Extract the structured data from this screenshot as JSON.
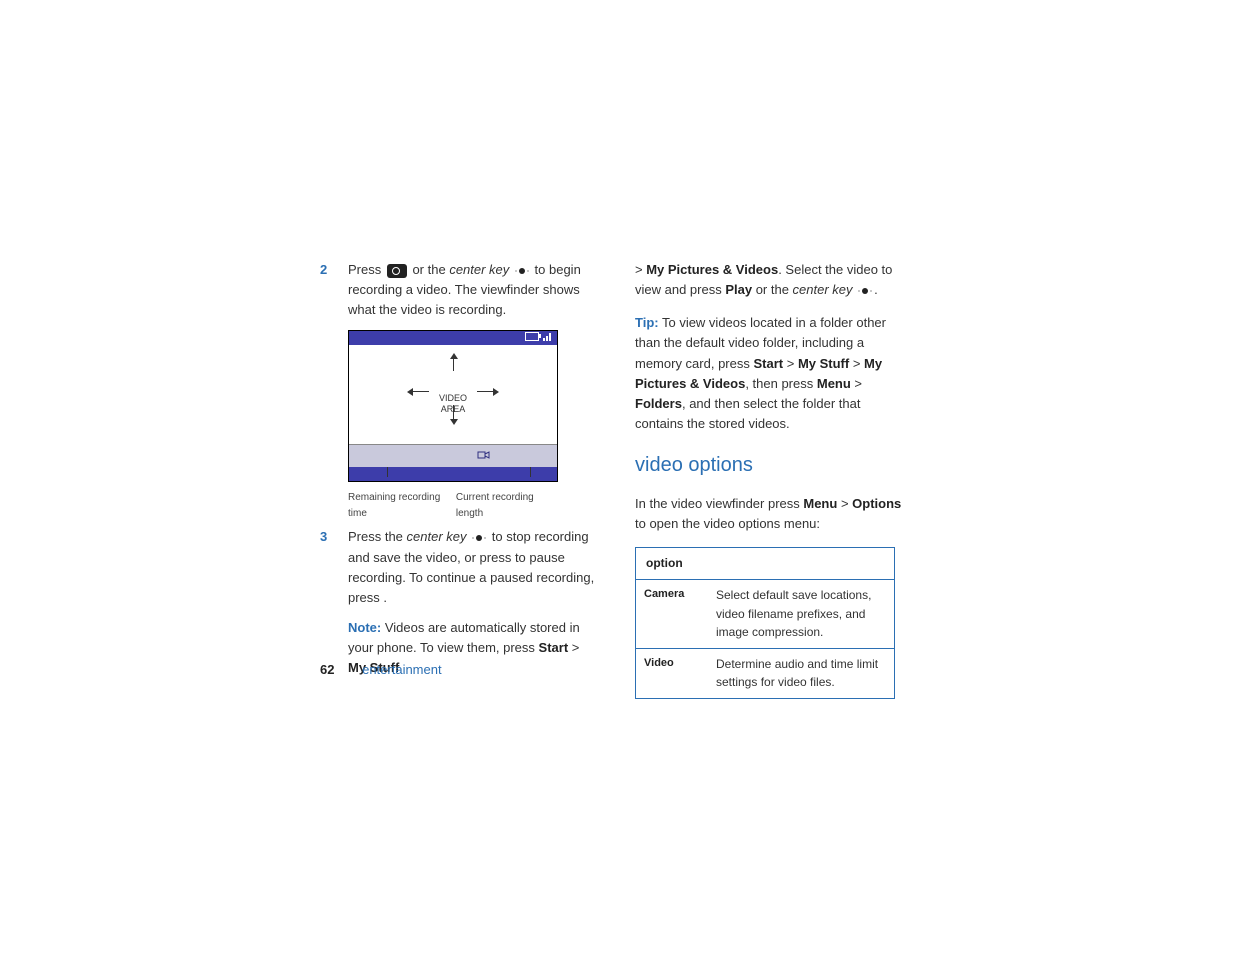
{
  "footer": {
    "page": "62",
    "section": "entertainment"
  },
  "left": {
    "step2": {
      "num": "2",
      "t1": "Press ",
      "t2": " or the ",
      "ck": "center key",
      "t3": " to begin recording a video. The viewfinder shows what the video is recording."
    },
    "vf": {
      "center1": "VIDEO",
      "center2": "AREA",
      "cal_l": "Remaining recording time",
      "cal_r": "Current recording length"
    },
    "step3": {
      "num": "3",
      "t1": "Press the ",
      "ck": "center key",
      "t2": " to stop recording and save the video, or press ",
      "pause_key": "",
      "t3": " to pause recording. To continue a paused recording, press ",
      "resume_key": "",
      "t4": "."
    },
    "note": {
      "label": "Note:",
      "t1": " Videos are automatically stored in your phone. To view them, press ",
      "p1": "Start",
      "gt1": " > ",
      "p2": "My Stuff"
    }
  },
  "right": {
    "cont": {
      "gt": "> ",
      "p1": "My Pictures & Videos",
      "t1": ". Select the video to view and press ",
      "p2": "Play",
      "t2": " or the ",
      "ck": "center key",
      "t3": "."
    },
    "tip": {
      "label": "Tip:",
      "t1": " To view videos located in a folder other than the default video folder, including a memory card, press ",
      "p_start": "Start",
      "g1": " > ",
      "p_mystuff": "My Stuff",
      "g2": " > ",
      "p_pics": "My Pictures & Videos",
      "t2": ", then press ",
      "p_menu": "Menu",
      "g3": " > ",
      "p_folders": "Folders",
      "t3": ", and then select the folder that contains the stored videos."
    },
    "heading": "video options",
    "intro": {
      "t1": "In the video viewfinder press ",
      "p_menu": "Menu",
      "g": " > ",
      "p_opt": "Options",
      "t2": " to open the video options menu:"
    },
    "table": {
      "header": "option",
      "rows": [
        {
          "name": "Camera",
          "desc": "Select default save locations, video filename prefixes, and image compression."
        },
        {
          "name": "Video",
          "desc": "Determine audio and time limit settings for video files."
        }
      ]
    }
  }
}
